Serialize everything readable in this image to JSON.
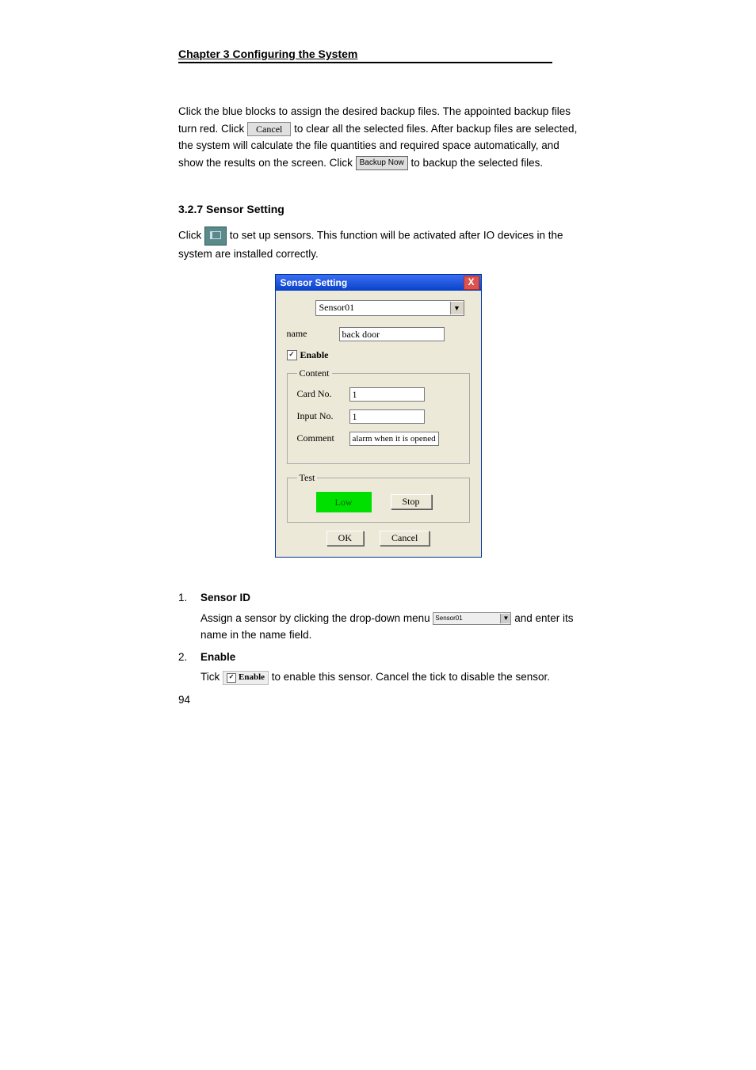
{
  "header": {
    "title": "Chapter 3    Configuring the System"
  },
  "intro": {
    "t1a": "Click the blue blocks to assign the desired backup files. The appointed backup files turn red. Click ",
    "cancel_btn": "Cancel",
    "t1b": " to clear all the selected files. After backup files are selected, the system will calculate the file quantities and required space automatically, and show the results on the screen. Click ",
    "backup_btn": "Backup Now",
    "t1c": " to backup the selected files."
  },
  "section": {
    "num_title": "3.2.7   Sensor Setting",
    "p2a": "Click ",
    "p2b": " to set up sensors. This function will be activated after IO devices in the system are installed correctly."
  },
  "dialog": {
    "title": "Sensor Setting",
    "close": "X",
    "select_value": "Sensor01",
    "name_label": "name",
    "name_value": "back door",
    "enable_label": "Enable",
    "check_mark": "✓",
    "content_legend": "Content",
    "cardno_label": "Card No.",
    "cardno_value": "1",
    "inputno_label": "Input No.",
    "inputno_value": "1",
    "comment_label": "Comment",
    "comment_value": "alarm when it is opened",
    "test_legend": "Test",
    "low_label": "Low",
    "stop_label": "Stop",
    "ok_label": "OK",
    "cancel_label": "Cancel"
  },
  "list": {
    "n1": "1.",
    "t1": "Sensor ID",
    "b1a": "Assign a sensor by clicking the drop-down menu",
    "mini_sel": "Sensor01",
    "b1b": " and enter its name in the name field.",
    "n2": "2.",
    "t2": "Enable",
    "b2a": "Tick ",
    "chip_label": "Enable",
    "b2b": " to enable this sensor. Cancel the tick to disable the sensor."
  },
  "page_number": "94"
}
